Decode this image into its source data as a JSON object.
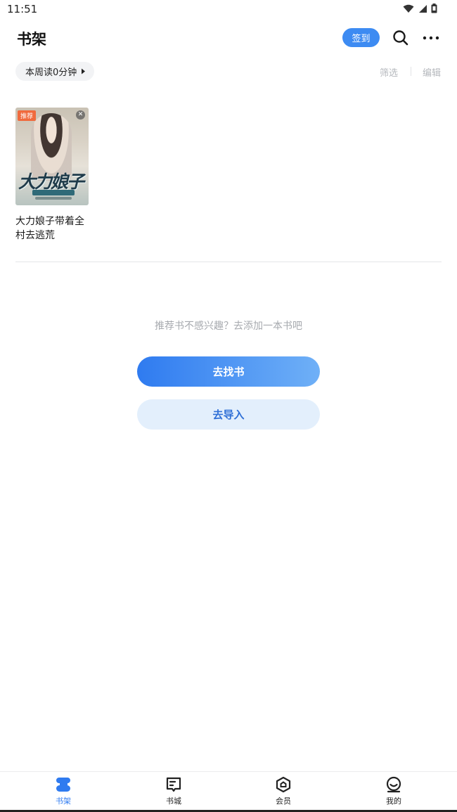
{
  "status_bar": {
    "time": "11:51"
  },
  "header": {
    "title": "书架",
    "checkin_label": "签到"
  },
  "reading": {
    "weekly_label": "本周读0分钟"
  },
  "filters": {
    "filter_label": "筛选",
    "edit_label": "编辑"
  },
  "books": [
    {
      "title": "大力娘子带着全村去逃荒",
      "badge": "推荐",
      "cover_art_title": "大力娘子"
    }
  ],
  "recommend": {
    "hint": "推荐书不感兴趣？去添加一本书吧",
    "find_label": "去找书",
    "import_label": "去导入"
  },
  "nav": {
    "items": [
      {
        "label": "书架",
        "icon": "bookshelf-icon",
        "active": true
      },
      {
        "label": "书城",
        "icon": "bookstore-icon",
        "active": false
      },
      {
        "label": "会员",
        "icon": "vip-icon",
        "active": false
      },
      {
        "label": "我的",
        "icon": "profile-icon",
        "active": false
      }
    ]
  },
  "colors": {
    "accent": "#2f7bf0",
    "badge": "#f06a3d"
  }
}
